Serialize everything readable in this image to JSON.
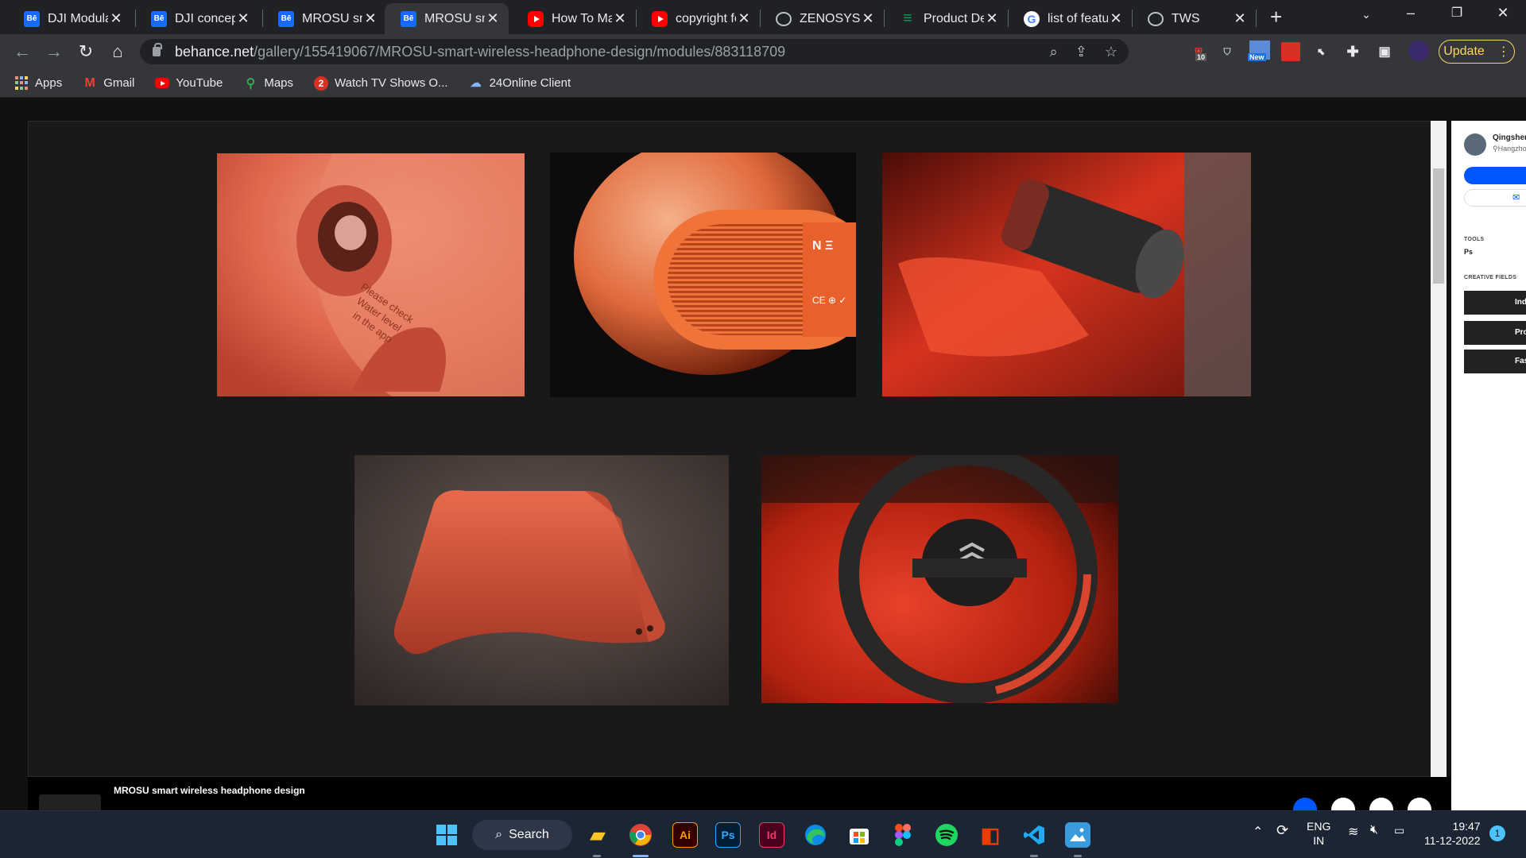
{
  "browser": {
    "tabs": [
      {
        "title": "DJI Modular",
        "favicon": "behance-icon"
      },
      {
        "title": "DJI concept",
        "favicon": "behance-icon"
      },
      {
        "title": "MROSU sm",
        "favicon": "behance-icon"
      },
      {
        "title": "MROSU sm",
        "favicon": "behance-icon",
        "active": true
      },
      {
        "title": "How To Ma",
        "favicon": "youtube-icon"
      },
      {
        "title": "copyright fo",
        "favicon": "youtube-icon"
      },
      {
        "title": "ZENOSYS",
        "favicon": "globe-icon"
      },
      {
        "title": "Product De",
        "favicon": "productboard-icon"
      },
      {
        "title": "list of featu",
        "favicon": "google-icon"
      },
      {
        "title": "TWS",
        "favicon": "globe-icon"
      }
    ],
    "url_host": "behance.net",
    "url_path": "/gallery/155419067/MROSU-smart-wireless-headphone-design/modules/883118709",
    "update_label": "Update",
    "extension_badge": "10",
    "extension_new": "New"
  },
  "bookmarks": [
    {
      "label": "Apps",
      "icon": "apps-grid-icon"
    },
    {
      "label": "Gmail",
      "icon": "gmail-icon"
    },
    {
      "label": "YouTube",
      "icon": "youtube-icon"
    },
    {
      "label": "Maps",
      "icon": "maps-icon"
    },
    {
      "label": "Watch TV Shows O...",
      "icon": "watch-tv-icon"
    },
    {
      "label": "24Online Client",
      "icon": "cloud-icon"
    }
  ],
  "project": {
    "title": "MROSU smart wireless headphone design",
    "images": [
      {
        "name": "speaker-port-closeup-image"
      },
      {
        "name": "speaker-grille-closeup-image"
      },
      {
        "name": "speaker-in-car-cupholder-image"
      },
      {
        "name": "fabric-speaker-render-image"
      },
      {
        "name": "citroen-steering-wheel-image"
      }
    ]
  },
  "sidebar": {
    "owner_name": "Qingshen",
    "owner_location": "Hangzho",
    "tools_heading": "TOOLS",
    "tool": "Ps",
    "creative_fields_heading": "CREATIVE FIELDS",
    "fields": [
      "Indus",
      "Prod",
      "Fash"
    ]
  },
  "taskbar": {
    "search_label": "Search",
    "lang_line1": "ENG",
    "lang_line2": "IN",
    "time": "19:47",
    "date": "11-12-2022",
    "notification_count": "1",
    "colors": {
      "accent": "#1769ff",
      "bg": "#1c2533"
    }
  }
}
